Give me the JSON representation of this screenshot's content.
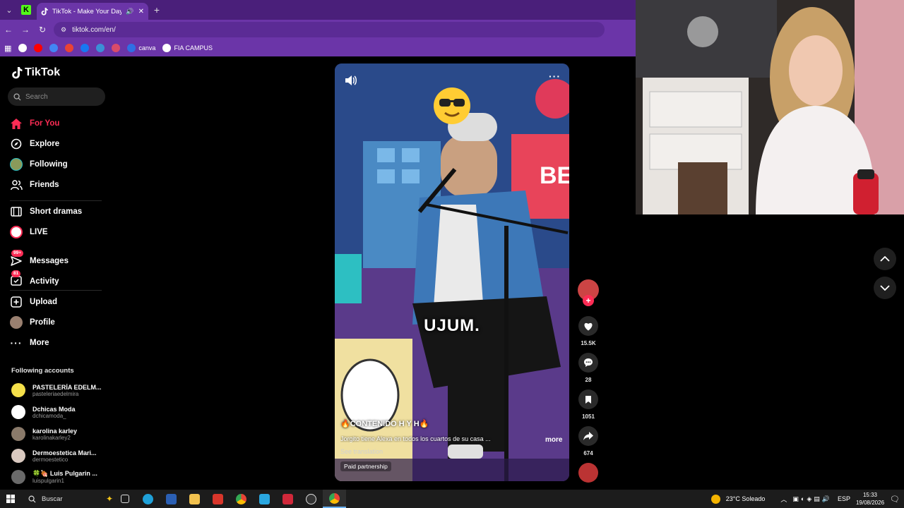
{
  "browser": {
    "tab_title": "TikTok - Make Your Day",
    "url": "tiktok.com/en/",
    "bookmarks": [
      {
        "label": "",
        "icon": "google-icon",
        "color": "#ffffff"
      },
      {
        "label": "",
        "icon": "youtube-icon",
        "color": "#ff0000"
      },
      {
        "label": "",
        "icon": "chrome-icon",
        "color": "#4285f4"
      },
      {
        "label": "",
        "icon": "gmail-icon",
        "color": "#ea4335"
      },
      {
        "label": "",
        "icon": "facebook-icon",
        "color": "#1877f2"
      },
      {
        "label": "",
        "icon": "app-icon",
        "color": "#3b8fd6"
      },
      {
        "label": "",
        "icon": "pen-icon",
        "color": "#d94b6a"
      },
      {
        "label": "canva",
        "icon": "canva-icon",
        "color": "#2f6fe4"
      },
      {
        "label": "FIA CAMPUS",
        "icon": "globe-icon",
        "color": "#ffffff"
      }
    ]
  },
  "tiktok": {
    "brand": "TikTok",
    "search_placeholder": "Search",
    "nav": [
      {
        "label": "For You",
        "icon": "home-icon",
        "active": true
      },
      {
        "label": "Explore",
        "icon": "compass-icon"
      },
      {
        "label": "Following",
        "icon": "following-avatar-icon"
      },
      {
        "label": "Friends",
        "icon": "friends-icon"
      },
      {
        "label": "Short dramas",
        "icon": "film-icon"
      },
      {
        "label": "LIVE",
        "icon": "live-icon"
      },
      {
        "label": "Messages",
        "icon": "messages-icon",
        "badge": "99+"
      },
      {
        "label": "Activity",
        "icon": "activity-icon",
        "badge": "81"
      },
      {
        "label": "Upload",
        "icon": "upload-icon"
      },
      {
        "label": "Profile",
        "icon": "profile-avatar-icon"
      },
      {
        "label": "More",
        "icon": "more-icon"
      }
    ],
    "following_title": "Following accounts",
    "accounts": [
      {
        "name": "PASTELERÍA EDELM...",
        "handle": "pasteleriaedelmira",
        "color": "#f5e04a"
      },
      {
        "name": "Dchicas Moda",
        "handle": "dchicamoda_",
        "color": "#ffffff"
      },
      {
        "name": "karolina karley",
        "handle": "karolinakarley2",
        "color": "#8a7a6a"
      },
      {
        "name": "Dermoestetica Mari...",
        "handle": "dermoestetico",
        "color": "#d9c9c0"
      },
      {
        "name": "🍀🍖 Luis Pulgarin ...",
        "handle": "luispulgarin1",
        "color": "#6a6a6a"
      }
    ]
  },
  "video": {
    "caption": "UJUM.",
    "title": "🔥CONTENIDO H Y H🔥",
    "description": "Jorgito tiene Alexa en todos los cuartos de su casa ...",
    "more": "more",
    "see_translation": "See translation",
    "paid": "Paid partnership",
    "likes": "15.5K",
    "comments": "28",
    "saves": "1051",
    "shares": "674"
  },
  "taskbar": {
    "search": "Buscar",
    "weather": "23°C  Soleado",
    "lang": "ESP",
    "time": "15:33",
    "date": "19/08/2026"
  }
}
